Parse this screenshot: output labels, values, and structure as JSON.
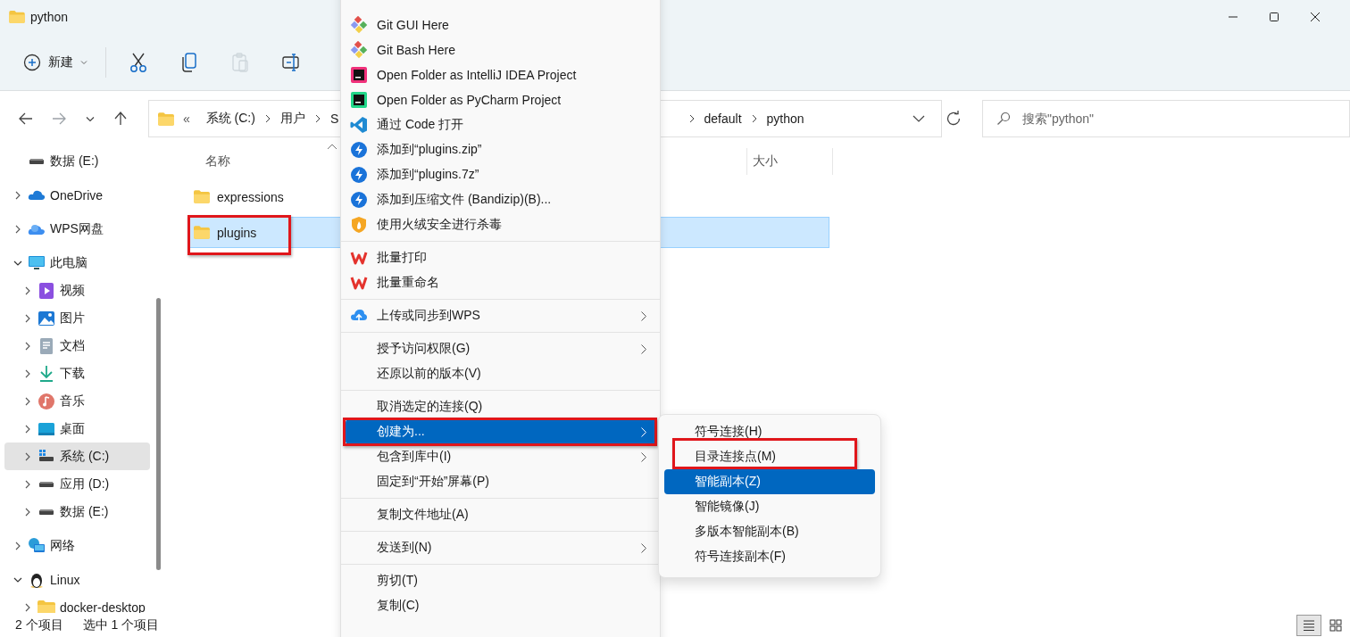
{
  "window": {
    "title": "python"
  },
  "toolbar": {
    "new_button": {
      "label": "新建"
    },
    "buttons": [
      {
        "kind": "cut",
        "disabled": false
      },
      {
        "kind": "copy",
        "disabled": false
      },
      {
        "kind": "paste",
        "disabled": true
      },
      {
        "kind": "rename",
        "disabled": false
      }
    ]
  },
  "nav": {
    "buttons": [
      {
        "kind": "back",
        "disabled": false
      },
      {
        "kind": "forward",
        "disabled": true
      },
      {
        "kind": "recent",
        "disabled": false
      },
      {
        "kind": "up",
        "disabled": false
      }
    ]
  },
  "address_bar": {
    "leading": "«",
    "segments_left": [
      "系统 (C:)",
      "用户",
      "S"
    ],
    "segments_right": [
      "default",
      "python"
    ]
  },
  "search": {
    "placeholder": "搜索\"python\""
  },
  "sidebar": {
    "items": [
      {
        "label": "数据 (E:)",
        "kind": "drive",
        "selected": false
      },
      {
        "label": "OneDrive",
        "kind": "onedrive",
        "expanded": false,
        "selected": false
      },
      {
        "label": "WPS网盘",
        "kind": "wps-cloud",
        "expanded": false,
        "selected": false
      },
      {
        "label": "此电脑",
        "kind": "monitor",
        "expanded": true,
        "selected": false,
        "children": [
          {
            "label": "视频",
            "kind": "video",
            "expanded": false,
            "selected": false
          },
          {
            "label": "图片",
            "kind": "picture",
            "expanded": false,
            "selected": false
          },
          {
            "label": "文档",
            "kind": "document",
            "expanded": false,
            "selected": false
          },
          {
            "label": "下载",
            "kind": "download",
            "expanded": false,
            "selected": false
          },
          {
            "label": "音乐",
            "kind": "music",
            "expanded": false,
            "selected": false
          },
          {
            "label": "桌面",
            "kind": "desktop",
            "expanded": false,
            "selected": false
          },
          {
            "label": "系统 (C:)",
            "kind": "system-drive",
            "expanded": false,
            "selected": true
          },
          {
            "label": "应用 (D:)",
            "kind": "drive",
            "expanded": false,
            "selected": false
          },
          {
            "label": "数据 (E:)",
            "kind": "drive",
            "expanded": false,
            "selected": false
          }
        ]
      },
      {
        "label": "网络",
        "kind": "network",
        "expanded": false,
        "selected": false
      },
      {
        "label": "Linux",
        "kind": "penguin",
        "expanded": true,
        "selected": false,
        "children": [
          {
            "label": "docker-desktop",
            "kind": "folder",
            "expanded": false,
            "selected": false
          }
        ]
      }
    ]
  },
  "file_list": {
    "columns": [
      "名称",
      "大小"
    ],
    "rows": [
      {
        "name": "expressions",
        "selected": false,
        "marked": false
      },
      {
        "name": "plugins",
        "selected": true,
        "marked": true
      }
    ]
  },
  "status_bar": {
    "item_count": "2 个项目",
    "selection": "选中 1 个项目",
    "views": [
      {
        "kind": "details",
        "selected": true
      },
      {
        "kind": "tiles",
        "selected": false
      }
    ]
  },
  "context_menu": {
    "groups": [
      [
        {
          "label": "Git GUI Here",
          "kind": "git",
          "submenu": false,
          "selected": false,
          "marked": false
        },
        {
          "label": "Git Bash Here",
          "kind": "git",
          "submenu": false,
          "selected": false,
          "marked": false
        },
        {
          "label": "Open Folder as IntelliJ IDEA Project",
          "kind": "intellij",
          "submenu": false,
          "selected": false,
          "marked": false
        },
        {
          "label": "Open Folder as PyCharm Project",
          "kind": "pycharm",
          "submenu": false,
          "selected": false,
          "marked": false
        },
        {
          "label": "通过 Code 打开",
          "kind": "vscode",
          "submenu": false,
          "selected": false,
          "marked": false
        },
        {
          "label": "添加到“plugins.zip”",
          "kind": "bandizip",
          "submenu": false,
          "selected": false,
          "marked": false
        },
        {
          "label": "添加到“plugins.7z”",
          "kind": "bandizip",
          "submenu": false,
          "selected": false,
          "marked": false
        },
        {
          "label": "添加到压缩文件 (Bandizip)(B)...",
          "kind": "bandizip",
          "submenu": false,
          "selected": false,
          "marked": false
        },
        {
          "label": "使用火绒安全进行杀毒",
          "kind": "shield",
          "submenu": false,
          "selected": false,
          "marked": false
        }
      ],
      [
        {
          "label": "批量打印",
          "kind": "wps",
          "submenu": false,
          "selected": false,
          "marked": false
        },
        {
          "label": "批量重命名",
          "kind": "wps",
          "submenu": false,
          "selected": false,
          "marked": false
        }
      ],
      [
        {
          "label": "上传或同步到WPS",
          "kind": "cloud-upload",
          "submenu": true,
          "selected": false,
          "marked": false
        }
      ],
      [
        {
          "label": "授予访问权限(G)",
          "kind": "plain",
          "submenu": true,
          "selected": false,
          "marked": false
        },
        {
          "label": "还原以前的版本(V)",
          "kind": "plain",
          "submenu": false,
          "selected": false,
          "marked": false
        }
      ],
      [
        {
          "label": "取消选定的连接(Q)",
          "kind": "plain",
          "submenu": false,
          "selected": false,
          "marked": false
        },
        {
          "label": "创建为...",
          "kind": "plain",
          "submenu": true,
          "selected": true,
          "marked": true
        },
        {
          "label": "包含到库中(I)",
          "kind": "plain",
          "submenu": true,
          "selected": false,
          "marked": false
        },
        {
          "label": "固定到“开始”屏幕(P)",
          "kind": "plain",
          "submenu": false,
          "selected": false,
          "marked": false
        }
      ],
      [
        {
          "label": "复制文件地址(A)",
          "kind": "plain",
          "submenu": false,
          "selected": false,
          "marked": false
        }
      ],
      [
        {
          "label": "发送到(N)",
          "kind": "plain",
          "submenu": true,
          "selected": false,
          "marked": false
        }
      ],
      [
        {
          "label": "剪切(T)",
          "kind": "plain",
          "submenu": false,
          "selected": false,
          "marked": false
        },
        {
          "label": "复制(C)",
          "kind": "plain",
          "submenu": false,
          "selected": false,
          "marked": false
        }
      ]
    ]
  },
  "submenu": {
    "items": [
      {
        "label": "符号连接(H)",
        "selected": false,
        "marked": false
      },
      {
        "label": "目录连接点(M)",
        "selected": false,
        "marked": true
      },
      {
        "label": "智能副本(Z)",
        "selected": true,
        "marked": false
      },
      {
        "label": "智能镜像(J)",
        "selected": false,
        "marked": false
      },
      {
        "label": "多版本智能副本(B)",
        "selected": false,
        "marked": false
      },
      {
        "label": "符号连接副本(F)",
        "selected": false,
        "marked": false
      }
    ]
  }
}
